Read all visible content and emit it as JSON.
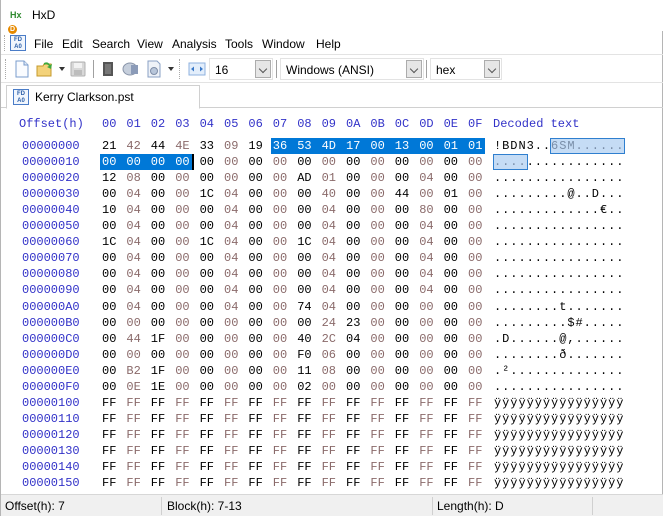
{
  "window": {
    "title": "HxD",
    "app_icon": "hxd-logo-icon"
  },
  "menubar": {
    "items": [
      "File",
      "Edit",
      "Search",
      "View",
      "Analysis",
      "Tools",
      "Window",
      "Help"
    ]
  },
  "toolbar": {
    "icons": [
      "new-file-icon",
      "open-folder-icon",
      "save-icon",
      "ram-icon",
      "disk-icon",
      "disk-image-icon",
      "bytes-per-row-icon"
    ],
    "bytes_per_row": "16",
    "charset": "Windows (ANSI)",
    "offset_base": "hex"
  },
  "tabs": [
    {
      "label": "Kerry Clarkson.pst",
      "icon": "hex-document-icon"
    }
  ],
  "hexview": {
    "offset_header": "Offset(h)",
    "column_headers": [
      "00",
      "01",
      "02",
      "03",
      "04",
      "05",
      "06",
      "07",
      "08",
      "09",
      "0A",
      "0B",
      "0C",
      "0D",
      "0E",
      "0F"
    ],
    "decoded_header": "Decoded text",
    "selection": {
      "start": 7,
      "end": 19
    },
    "rows": [
      {
        "offset": "00000000",
        "bytes": [
          "21",
          "42",
          "44",
          "4E",
          "33",
          "09",
          "19",
          "36",
          "53",
          "4D",
          "17",
          "00",
          "13",
          "00",
          "01",
          "01"
        ],
        "text": "!BDN3..6SM......"
      },
      {
        "offset": "00000010",
        "bytes": [
          "00",
          "00",
          "00",
          "00",
          "00",
          "00",
          "00",
          "00",
          "00",
          "00",
          "00",
          "00",
          "00",
          "00",
          "00",
          "00"
        ],
        "text": "................"
      },
      {
        "offset": "00000020",
        "bytes": [
          "12",
          "08",
          "00",
          "00",
          "00",
          "00",
          "00",
          "00",
          "AD",
          "01",
          "00",
          "00",
          "00",
          "04",
          "00",
          "00"
        ],
        "text": "................"
      },
      {
        "offset": "00000030",
        "bytes": [
          "00",
          "04",
          "00",
          "00",
          "1C",
          "04",
          "00",
          "00",
          "00",
          "40",
          "00",
          "00",
          "44",
          "00",
          "01",
          "00"
        ],
        "text": ".........@..D..."
      },
      {
        "offset": "00000040",
        "bytes": [
          "10",
          "04",
          "00",
          "00",
          "00",
          "04",
          "00",
          "00",
          "00",
          "04",
          "00",
          "00",
          "00",
          "80",
          "00",
          "00"
        ],
        "text": ".............€.."
      },
      {
        "offset": "00000050",
        "bytes": [
          "00",
          "04",
          "00",
          "00",
          "00",
          "04",
          "00",
          "00",
          "00",
          "04",
          "00",
          "00",
          "00",
          "04",
          "00",
          "00"
        ],
        "text": "................"
      },
      {
        "offset": "00000060",
        "bytes": [
          "1C",
          "04",
          "00",
          "00",
          "1C",
          "04",
          "00",
          "00",
          "1C",
          "04",
          "00",
          "00",
          "00",
          "04",
          "00",
          "00"
        ],
        "text": "................"
      },
      {
        "offset": "00000070",
        "bytes": [
          "00",
          "04",
          "00",
          "00",
          "00",
          "04",
          "00",
          "00",
          "00",
          "04",
          "00",
          "00",
          "00",
          "04",
          "00",
          "00"
        ],
        "text": "................"
      },
      {
        "offset": "00000080",
        "bytes": [
          "00",
          "04",
          "00",
          "00",
          "00",
          "04",
          "00",
          "00",
          "00",
          "04",
          "00",
          "00",
          "00",
          "04",
          "00",
          "00"
        ],
        "text": "................"
      },
      {
        "offset": "00000090",
        "bytes": [
          "00",
          "04",
          "00",
          "00",
          "00",
          "04",
          "00",
          "00",
          "00",
          "04",
          "00",
          "00",
          "00",
          "04",
          "00",
          "00"
        ],
        "text": "................"
      },
      {
        "offset": "000000A0",
        "bytes": [
          "00",
          "04",
          "00",
          "00",
          "00",
          "04",
          "00",
          "00",
          "74",
          "04",
          "00",
          "00",
          "00",
          "00",
          "00",
          "00"
        ],
        "text": "........t......."
      },
      {
        "offset": "000000B0",
        "bytes": [
          "00",
          "00",
          "00",
          "00",
          "00",
          "00",
          "00",
          "00",
          "00",
          "24",
          "23",
          "00",
          "00",
          "00",
          "00",
          "00"
        ],
        "text": ".........$#....."
      },
      {
        "offset": "000000C0",
        "bytes": [
          "00",
          "44",
          "1F",
          "00",
          "00",
          "00",
          "00",
          "00",
          "40",
          "2C",
          "04",
          "00",
          "00",
          "00",
          "00",
          "00"
        ],
        "text": ".D......@,......"
      },
      {
        "offset": "000000D0",
        "bytes": [
          "00",
          "00",
          "00",
          "00",
          "00",
          "00",
          "00",
          "00",
          "F0",
          "06",
          "00",
          "00",
          "00",
          "00",
          "00",
          "00"
        ],
        "text": "........ð......."
      },
      {
        "offset": "000000E0",
        "bytes": [
          "00",
          "B2",
          "1F",
          "00",
          "00",
          "00",
          "00",
          "00",
          "11",
          "08",
          "00",
          "00",
          "00",
          "00",
          "00",
          "00"
        ],
        "text": ".².............."
      },
      {
        "offset": "000000F0",
        "bytes": [
          "00",
          "0E",
          "1E",
          "00",
          "00",
          "00",
          "00",
          "00",
          "02",
          "00",
          "00",
          "00",
          "00",
          "00",
          "00",
          "00"
        ],
        "text": "................"
      },
      {
        "offset": "00000100",
        "bytes": [
          "FF",
          "FF",
          "FF",
          "FF",
          "FF",
          "FF",
          "FF",
          "FF",
          "FF",
          "FF",
          "FF",
          "FF",
          "FF",
          "FF",
          "FF",
          "FF"
        ],
        "text": "ÿÿÿÿÿÿÿÿÿÿÿÿÿÿÿÿ"
      },
      {
        "offset": "00000110",
        "bytes": [
          "FF",
          "FF",
          "FF",
          "FF",
          "FF",
          "FF",
          "FF",
          "FF",
          "FF",
          "FF",
          "FF",
          "FF",
          "FF",
          "FF",
          "FF",
          "FF"
        ],
        "text": "ÿÿÿÿÿÿÿÿÿÿÿÿÿÿÿÿ"
      },
      {
        "offset": "00000120",
        "bytes": [
          "FF",
          "FF",
          "FF",
          "FF",
          "FF",
          "FF",
          "FF",
          "FF",
          "FF",
          "FF",
          "FF",
          "FF",
          "FF",
          "FF",
          "FF",
          "FF"
        ],
        "text": "ÿÿÿÿÿÿÿÿÿÿÿÿÿÿÿÿ"
      },
      {
        "offset": "00000130",
        "bytes": [
          "FF",
          "FF",
          "FF",
          "FF",
          "FF",
          "FF",
          "FF",
          "FF",
          "FF",
          "FF",
          "FF",
          "FF",
          "FF",
          "FF",
          "FF",
          "FF"
        ],
        "text": "ÿÿÿÿÿÿÿÿÿÿÿÿÿÿÿÿ"
      },
      {
        "offset": "00000140",
        "bytes": [
          "FF",
          "FF",
          "FF",
          "FF",
          "FF",
          "FF",
          "FF",
          "FF",
          "FF",
          "FF",
          "FF",
          "FF",
          "FF",
          "FF",
          "FF",
          "FF"
        ],
        "text": "ÿÿÿÿÿÿÿÿÿÿÿÿÿÿÿÿ"
      },
      {
        "offset": "00000150",
        "bytes": [
          "FF",
          "FF",
          "FF",
          "FF",
          "FF",
          "FF",
          "FF",
          "FF",
          "FF",
          "FF",
          "FF",
          "FF",
          "FF",
          "FF",
          "FF",
          "FF"
        ],
        "text": "ÿÿÿÿÿÿÿÿÿÿÿÿÿÿÿÿ"
      }
    ]
  },
  "statusbar": {
    "offset": "Offset(h): 7",
    "block": "Block(h): 7-13",
    "length": "Length(h): D"
  },
  "colors": {
    "offset_text": "#3232c8",
    "selection": "#0078d7",
    "decoded_selection": "#c5dcf5",
    "odd_column": "#8a6a6a"
  }
}
